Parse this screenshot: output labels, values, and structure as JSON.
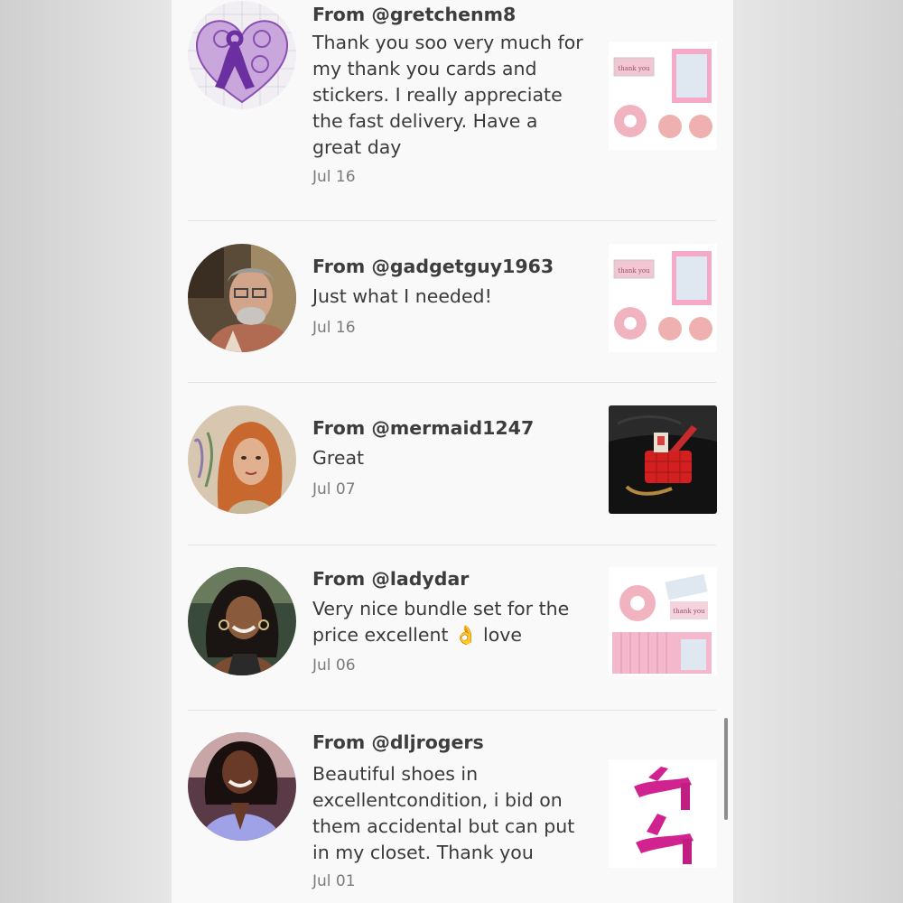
{
  "reviews": [
    {
      "from": "From @gretchenm8",
      "text": "Thank you soo very much for my thank you cards and stickers. I really appreciate the fast delivery. Have a great day",
      "date": "Jul 16",
      "avatar_icon": "purple-heart-ribbon-avatar",
      "thumb_icon": "thank-you-stationery-set"
    },
    {
      "from": "From @gadgetguy1963",
      "text": "Just what I needed!",
      "date": "Jul 16",
      "avatar_icon": "man-with-glasses-avatar",
      "thumb_icon": "thank-you-stationery-set"
    },
    {
      "from": "From @mermaid1247",
      "text": "Great",
      "date": "Jul 07",
      "avatar_icon": "woman-red-hair-avatar",
      "thumb_icon": "red-handbag-photo"
    },
    {
      "from": "From @ladydar",
      "text": "Very nice bundle set for the price excellent 👌 love",
      "date": "Jul 06",
      "avatar_icon": "woman-smiling-avatar",
      "thumb_icon": "sticker-bundle-set"
    },
    {
      "from": "From @dljrogers",
      "text": "Beautiful shoes in excellentcondition, i bid on them accidental but can put in my closet. Thank you",
      "date": "Jul 01",
      "avatar_icon": "woman-purple-top-avatar",
      "thumb_icon": "pink-heels-photo"
    }
  ],
  "colors": {
    "panel_bg": "#faf9fa",
    "username": "#3d3d3d",
    "date": "#7b7b7b",
    "divider": "#e3e1e3"
  }
}
